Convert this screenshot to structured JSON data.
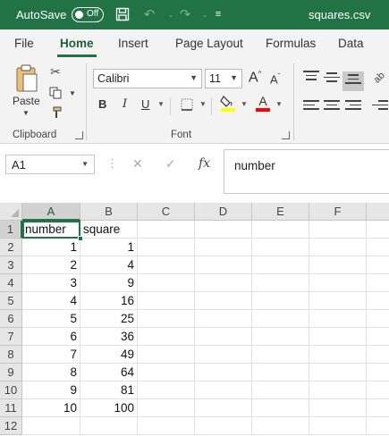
{
  "titlebar": {
    "autosave_label": "AutoSave",
    "autosave_state": "Off",
    "filename": "squares.csv"
  },
  "ribbon_tabs": [
    "File",
    "Home",
    "Insert",
    "Page Layout",
    "Formulas",
    "Data"
  ],
  "active_tab": "Home",
  "clipboard": {
    "paste_label": "Paste",
    "group_label": "Clipboard"
  },
  "font": {
    "name": "Calibri",
    "size": "11",
    "group_label": "Font",
    "bold_label": "B",
    "italic_label": "I",
    "underline_label": "U",
    "grow_label": "A",
    "shrink_label": "A",
    "color_label": "A",
    "highlight_color": "#ffff00",
    "font_color": "#ff0000"
  },
  "formula_bar": {
    "name_box": "A1",
    "fx_label": "fx",
    "content": "number"
  },
  "sheet": {
    "columns": [
      "A",
      "B",
      "C",
      "D",
      "E",
      "F"
    ],
    "rows": [
      {
        "num": "1",
        "a": "number",
        "b": "square"
      },
      {
        "num": "2",
        "a": "1",
        "b": "1"
      },
      {
        "num": "3",
        "a": "2",
        "b": "4"
      },
      {
        "num": "4",
        "a": "3",
        "b": "9"
      },
      {
        "num": "5",
        "a": "4",
        "b": "16"
      },
      {
        "num": "6",
        "a": "5",
        "b": "25"
      },
      {
        "num": "7",
        "a": "6",
        "b": "36"
      },
      {
        "num": "8",
        "a": "7",
        "b": "49"
      },
      {
        "num": "9",
        "a": "8",
        "b": "64"
      },
      {
        "num": "10",
        "a": "9",
        "b": "81"
      },
      {
        "num": "11",
        "a": "10",
        "b": "100"
      },
      {
        "num": "12",
        "a": "",
        "b": ""
      }
    ]
  },
  "colors": {
    "accent": "#217346"
  }
}
